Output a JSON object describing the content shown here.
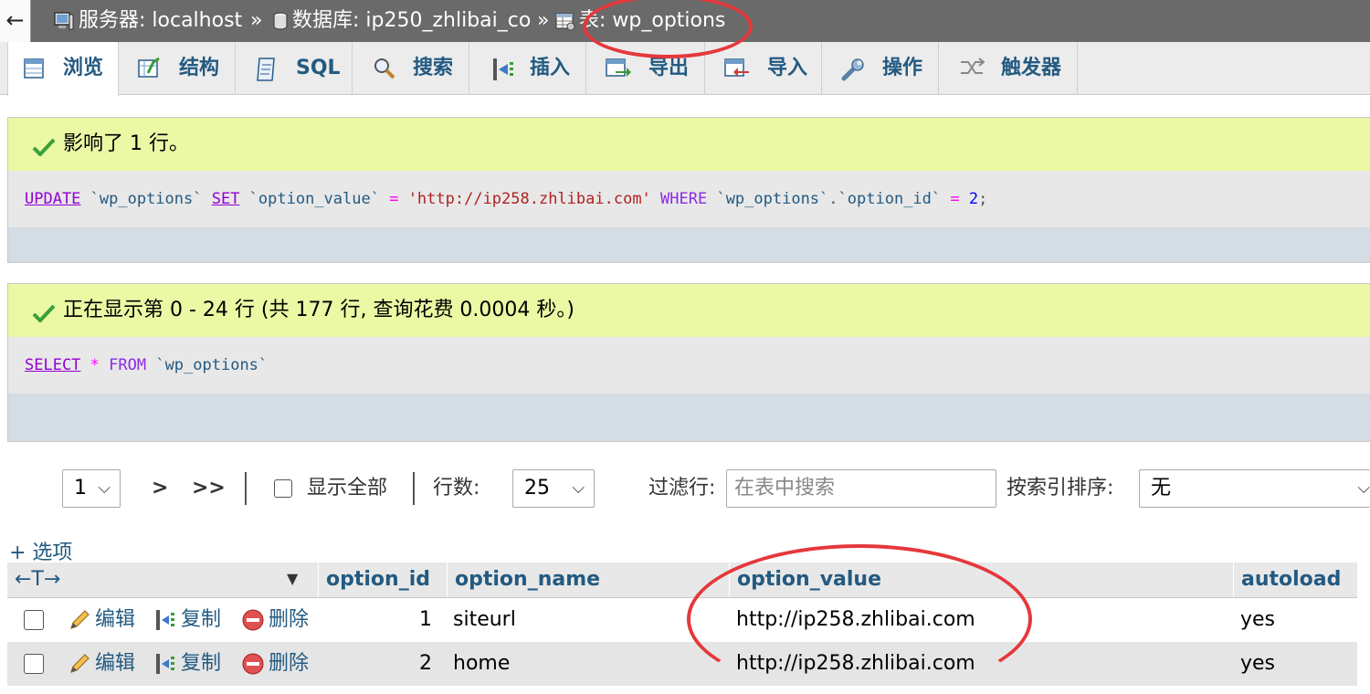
{
  "breadcrumb": {
    "back": "←",
    "server": "服务器: localhost",
    "sep1": "»",
    "database": "数据库: ip250_zhlibai_co",
    "sep2": "»",
    "table": "表: wp_options"
  },
  "tabs": [
    {
      "label": "浏览",
      "icon": "browse-icon"
    },
    {
      "label": "结构",
      "icon": "structure-icon"
    },
    {
      "label": "SQL",
      "icon": "sql-icon"
    },
    {
      "label": "搜索",
      "icon": "search-icon"
    },
    {
      "label": "插入",
      "icon": "insert-icon"
    },
    {
      "label": "导出",
      "icon": "export-icon"
    },
    {
      "label": "导入",
      "icon": "import-icon"
    },
    {
      "label": "操作",
      "icon": "wrench-icon"
    },
    {
      "label": "触发器",
      "icon": "trigger-icon"
    }
  ],
  "messages": {
    "update_result": "影响了 1 行。",
    "update_sql": {
      "p1": "UPDATE",
      "p2": " `wp_options` ",
      "p3": "SET",
      "p4": " `option_value` ",
      "p5": "=",
      "p6": " 'http://ip258.zhlibai.com' ",
      "p7": "WHERE",
      "p8": " `wp_options`",
      "p9": ".",
      "p10": "`option_id` ",
      "p11": "=",
      "p12": " 2",
      "p13": ";"
    },
    "select_result": "正在显示第 0 - 24 行 (共 177 行, 查询花费 0.0004 秒。)",
    "select_sql": {
      "p1": "SELECT",
      "p2": " * ",
      "p3": "FROM",
      "p4": " `wp_options`"
    }
  },
  "nav": {
    "page": "1",
    "next": ">",
    "last": ">>",
    "show_all": "显示全部",
    "rows_label": "行数:",
    "rows_value": "25",
    "filter_label": "过滤行:",
    "filter_placeholder": "在表中搜索",
    "sort_label": "按索引排序:",
    "sort_value": "无"
  },
  "table": {
    "options_link": "+ 选项",
    "arrows": "←T→",
    "sort_caret": "▼",
    "columns": [
      "option_id",
      "option_name",
      "option_value",
      "autoload"
    ],
    "actions": {
      "edit": "编辑",
      "copy": "复制",
      "delete": "删除"
    },
    "rows": [
      {
        "option_id": "1",
        "option_name": "siteurl",
        "option_value": "http://ip258.zhlibai.com",
        "autoload": "yes"
      },
      {
        "option_id": "2",
        "option_name": "home",
        "option_value": "http://ip258.zhlibai.com",
        "autoload": "yes"
      }
    ]
  },
  "colors": {
    "topbar": "#6a6a6a",
    "link": "#235a81",
    "success_bg": "#ebf8a4",
    "annotation": "#e5383b"
  }
}
